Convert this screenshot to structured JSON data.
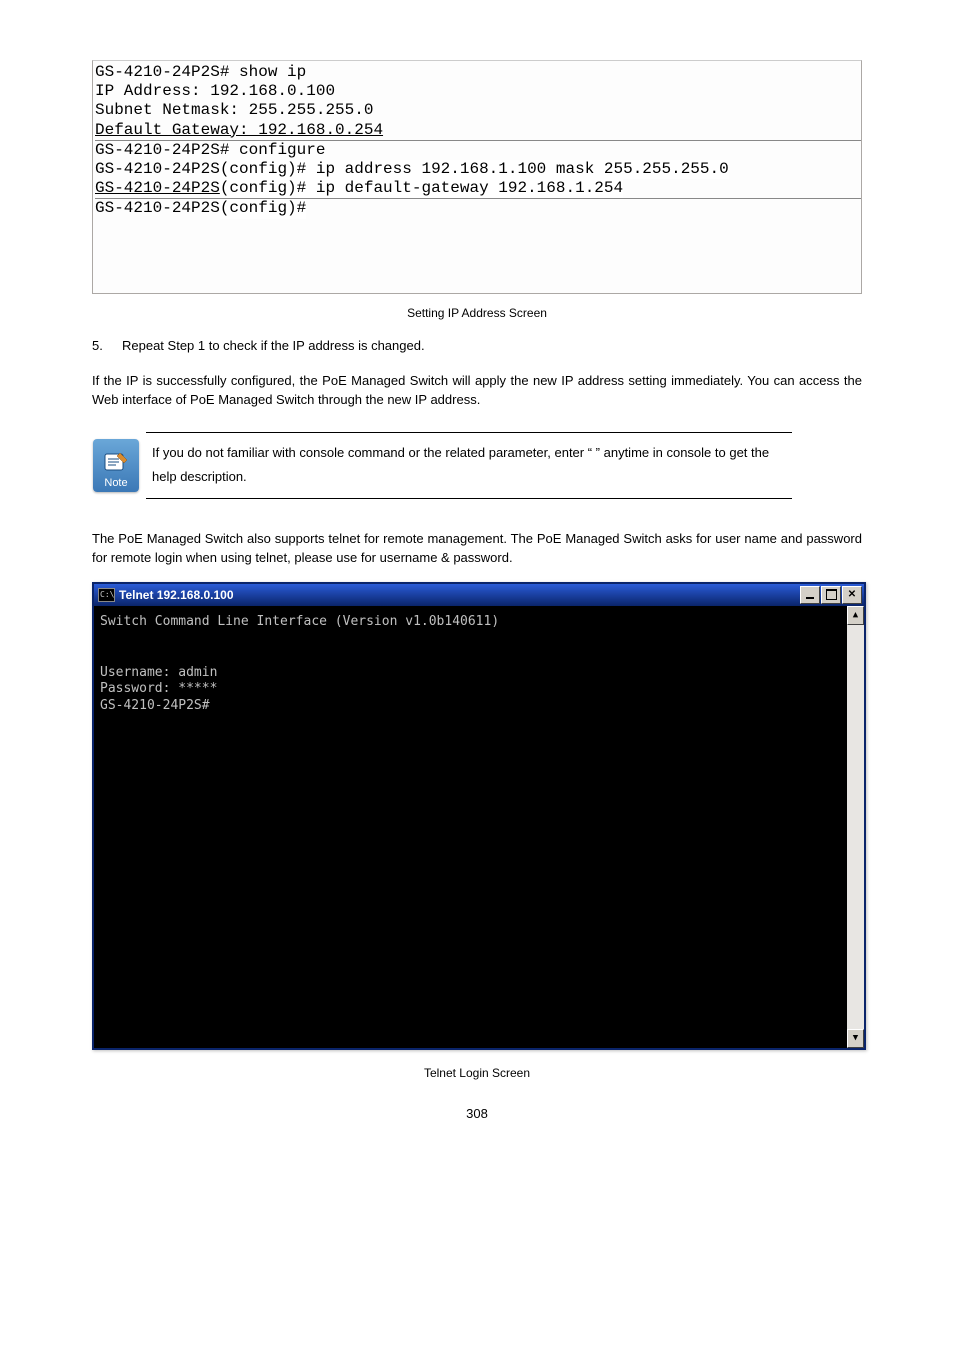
{
  "console": {
    "line1a": "GS-4210-24P2S",
    "line1b": "# show ip",
    "line2": "IP Address: 192.168.0.100",
    "line3": "Subnet Netmask: 255.255.255.0",
    "line4": "Default Gateway: 192.168.0.254",
    "line5a": "GS-4210-24P2S",
    "line5b": "# configure",
    "line6a": "GS-4210-24P2S",
    "line6b": "(config)# ip address 192.168.1.100 mask 255.255.255.0",
    "line7a": "GS-4210-24P2S",
    "line7b": "(config)# ip default-gateway 192.168.1.254",
    "line8a": "GS-4210-24P2S",
    "line8b": "(config)#"
  },
  "caption1": "Setting IP Address Screen",
  "step5_num": "5.",
  "step5": "Repeat Step 1 to check if the IP address is changed.",
  "para1": "If the IP is successfully configured, the PoE Managed Switch will apply the new IP address setting immediately. You can access the Web interface of PoE Managed Switch through the new IP address.",
  "note_label": "Note",
  "note_text": "If you do not familiar with console command or the related parameter, enter “ ” anytime in console to get the help description.",
  "para2a": "The PoE Managed Switch also supports telnet for remote management. The PoE Managed Switch asks for user name and password for remote login when using telnet, please use ",
  "para2b": " for username & password.",
  "telnet": {
    "title_prefix": "C:\\",
    "title": "Telnet 192.168.0.100",
    "line1": "Switch Command Line Interface (Version v1.0b140611)",
    "line2": "Username: admin",
    "line3": "Password: *****",
    "line4": "GS-4210-24P2S#"
  },
  "caption2": "Telnet Login Screen",
  "page_number": "308",
  "chart_data": null
}
